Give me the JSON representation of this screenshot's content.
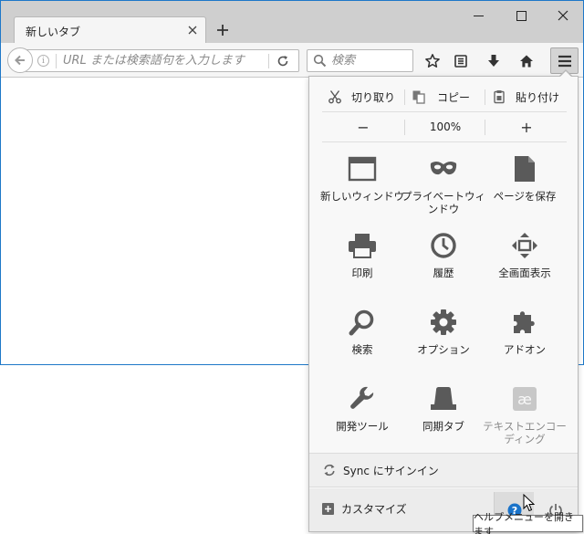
{
  "tab": {
    "title": "新しいタブ"
  },
  "navbar": {
    "url_placeholder": "URL または検索語句を入力します",
    "search_placeholder": "検索"
  },
  "menu": {
    "edit": {
      "cut": "切り取り",
      "copy": "コピー",
      "paste": "貼り付け"
    },
    "zoom": {
      "minus": "−",
      "value": "100%",
      "plus": "+"
    },
    "items": [
      {
        "label": "新しいウィンドウ",
        "icon": "window-icon"
      },
      {
        "label": "プライベートウィンドウ",
        "icon": "mask-icon"
      },
      {
        "label": "ページを保存",
        "icon": "document-icon"
      },
      {
        "label": "印刷",
        "icon": "printer-icon"
      },
      {
        "label": "履歴",
        "icon": "clock-icon"
      },
      {
        "label": "全画面表示",
        "icon": "fullscreen-icon"
      },
      {
        "label": "検索",
        "icon": "magnifier-icon"
      },
      {
        "label": "オプション",
        "icon": "gear-icon"
      },
      {
        "label": "アドオン",
        "icon": "puzzle-icon"
      },
      {
        "label": "開発ツール",
        "icon": "wrench-icon"
      },
      {
        "label": "同期タブ",
        "icon": "synced-tabs-icon"
      },
      {
        "label": "テキストエンコーディング",
        "icon": "text-encoding-icon",
        "disabled": true
      }
    ],
    "sync": {
      "label": "Sync にサインイン"
    },
    "customize": {
      "label": "カスタマイズ"
    }
  },
  "tooltip": {
    "text": "ヘルプメニューを開きます"
  },
  "colors": {
    "accent_blue": "#1e78c8",
    "icon_gray": "#5a5a5a",
    "help_blue": "#1a73c9"
  }
}
